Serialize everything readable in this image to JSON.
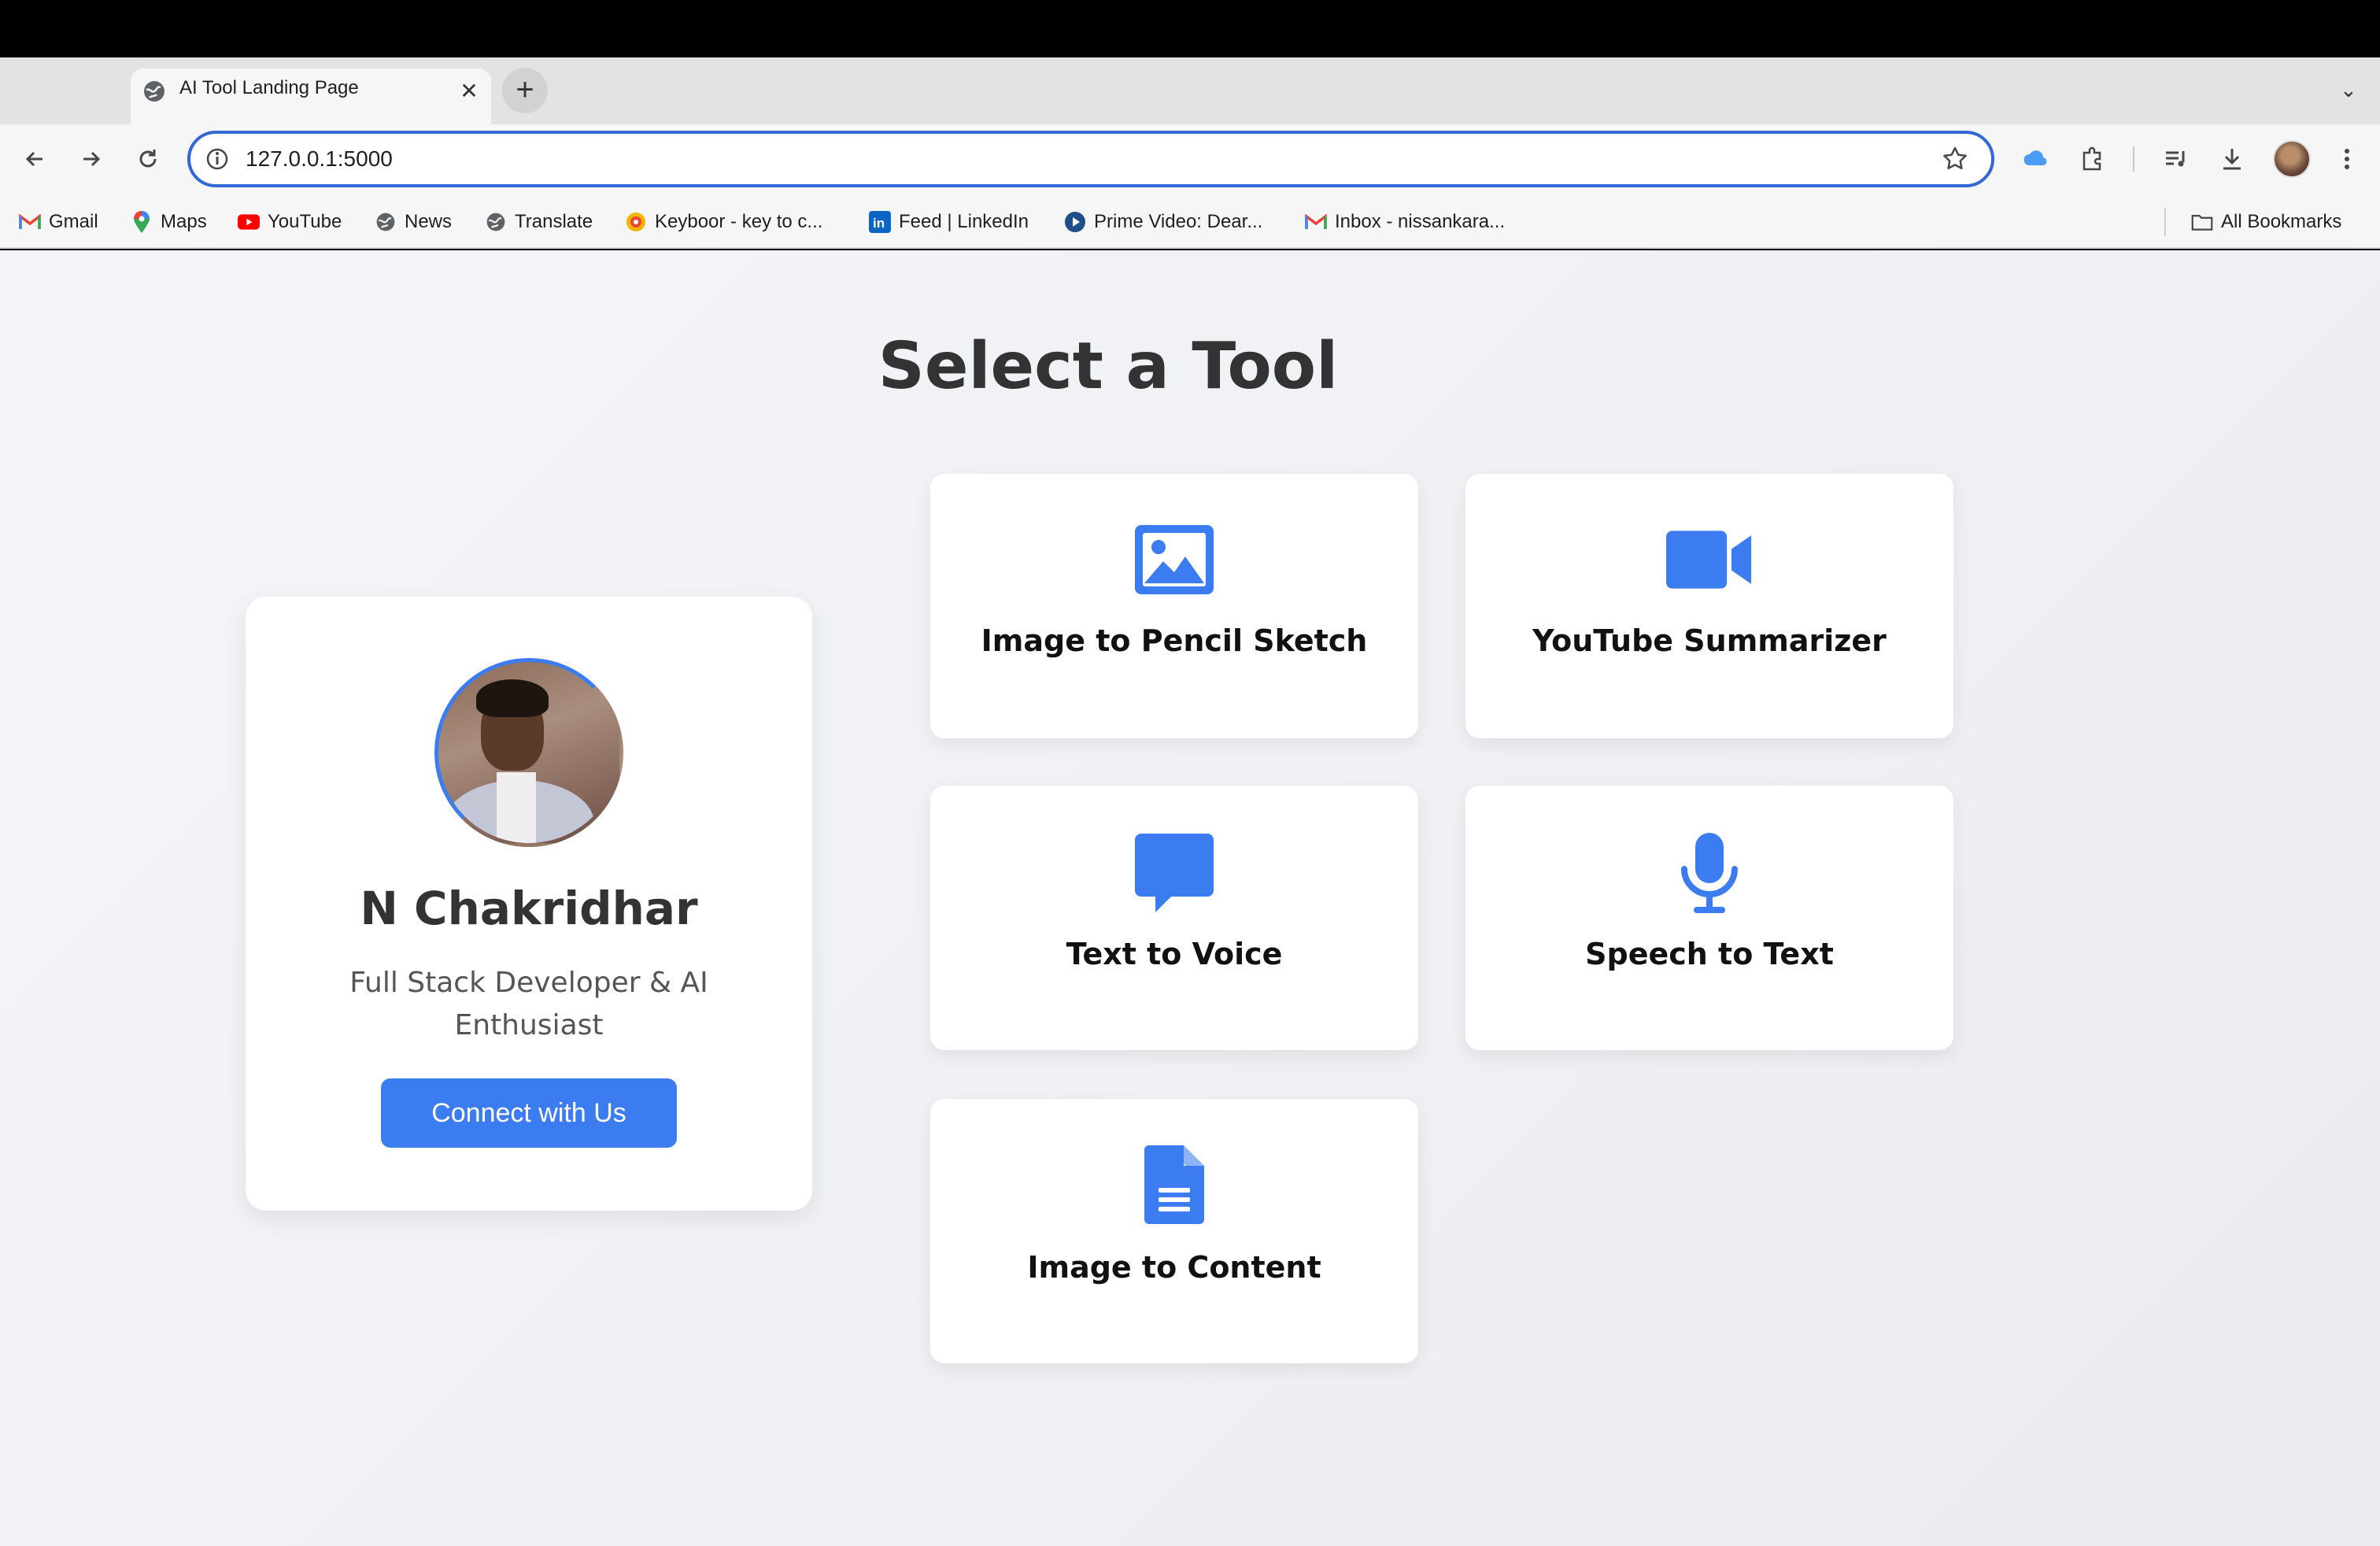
{
  "browser": {
    "tab_title": "AI Tool Landing Page",
    "url": "127.0.0.1:5000",
    "bookmarks": [
      {
        "label": "Gmail",
        "icon": "gmail-icon"
      },
      {
        "label": "Maps",
        "icon": "maps-icon"
      },
      {
        "label": "YouTube",
        "icon": "youtube-icon"
      },
      {
        "label": "News",
        "icon": "globe-icon"
      },
      {
        "label": "Translate",
        "icon": "globe-icon"
      },
      {
        "label": "Keyboor - key to c...",
        "icon": "keyboor-icon"
      },
      {
        "label": "Feed | LinkedIn",
        "icon": "linkedin-icon"
      },
      {
        "label": "Prime Video: Dear...",
        "icon": "prime-video-icon"
      },
      {
        "label": "Inbox - nissankara...",
        "icon": "gmail-icon"
      }
    ],
    "all_bookmarks_label": "All Bookmarks"
  },
  "page": {
    "title": "Select a Tool",
    "profile": {
      "name": "N Chakridhar",
      "role": "Full Stack Developer & AI Enthusiast",
      "button": "Connect with Us"
    },
    "tools": [
      {
        "label": "Image to Pencil Sketch",
        "icon": "image-icon"
      },
      {
        "label": "YouTube Summarizer",
        "icon": "video-camera-icon"
      },
      {
        "label": "Text to Voice",
        "icon": "chat-bubble-icon"
      },
      {
        "label": "Speech to Text",
        "icon": "microphone-icon"
      },
      {
        "label": "Image to Content",
        "icon": "document-icon"
      }
    ]
  },
  "colors": {
    "accent": "#3b7cf0",
    "title_text": "#333333",
    "page_bg": "#f0f2f5"
  }
}
